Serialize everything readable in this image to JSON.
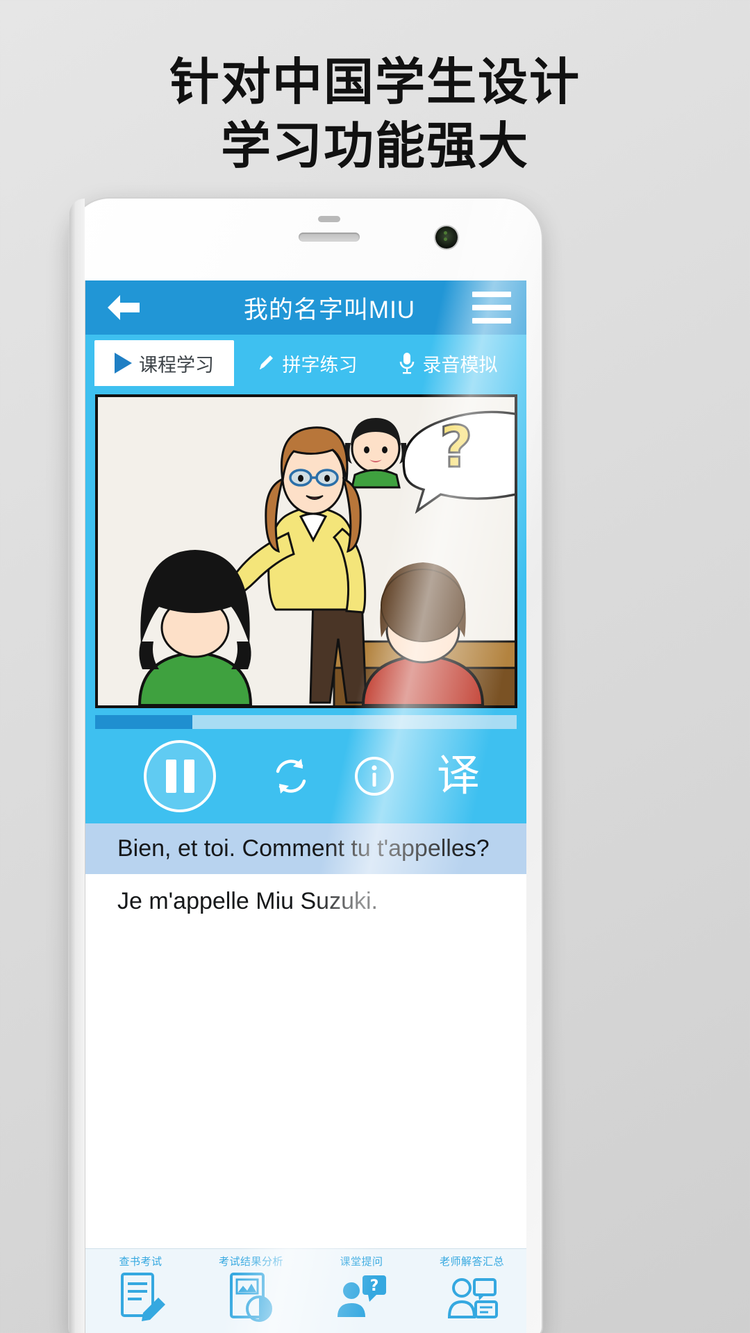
{
  "headline": {
    "line1": "针对中国学生设计",
    "line2": "学习功能强大"
  },
  "colors": {
    "nav_blue": "#2196d6",
    "tab_blue": "#3ec0f0",
    "progress_fill": "#1f8fd0",
    "progress_track": "#a8dcf3",
    "subtitle_highlight": "#b8d3ef",
    "toolbar_bg": "#eef6fb",
    "toolbar_accent": "#35a8e0",
    "page_bg": "#e0e0e0"
  },
  "app": {
    "navbar": {
      "back_icon": "arrow-left-icon",
      "title": "我的名字叫MIU",
      "menu_icon": "hamburger-menu-icon"
    },
    "tabs": [
      {
        "label": "课程学习",
        "icon": "play-triangle-icon",
        "active": true
      },
      {
        "label": "拼字练习",
        "icon": "pencil-icon",
        "active": false
      },
      {
        "label": "录音模拟",
        "icon": "microphone-icon",
        "active": false
      }
    ],
    "lesson": {
      "scene_description": "课堂插图：女教师指向学生，思考气泡中出现女生头像与问号",
      "speech_bubble_icon": "question-mark-icon"
    },
    "progress": {
      "percent": 23
    },
    "controls": [
      {
        "name": "pause-button",
        "icon": "pause-icon",
        "label": ""
      },
      {
        "name": "repeat-button",
        "icon": "repeat-icon",
        "label": ""
      },
      {
        "name": "info-button",
        "icon": "info-circle-icon",
        "label": ""
      },
      {
        "name": "translate-button",
        "icon": "translate-icon",
        "label": "译"
      }
    ],
    "subtitles": {
      "primary": "Bien, et toi. Comment tu t'appelles?",
      "secondary": "Je m'appelle Miu Suzuki."
    },
    "bottom_toolbar": [
      {
        "label": "查书考试",
        "icon": "exam-paper-icon"
      },
      {
        "label": "考试结果分析",
        "icon": "result-chart-icon"
      },
      {
        "label": "课堂提问",
        "icon": "question-person-icon"
      },
      {
        "label": "老师解答汇总",
        "icon": "teacher-answer-icon"
      }
    ]
  }
}
